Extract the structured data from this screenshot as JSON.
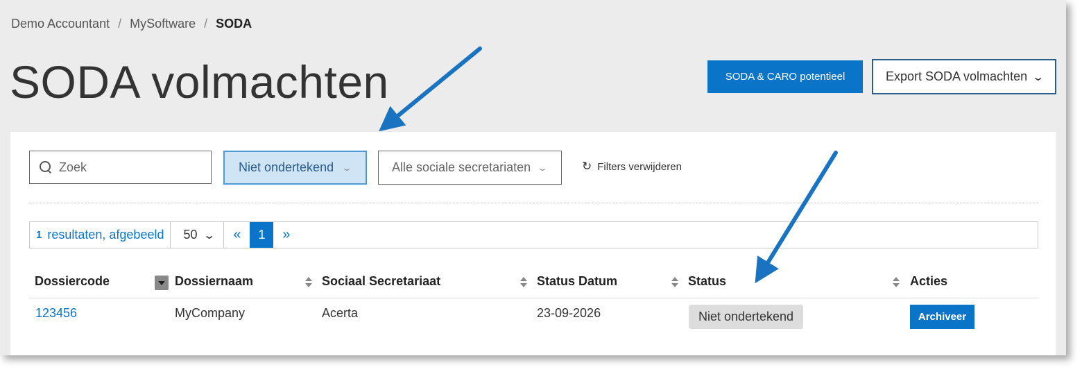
{
  "breadcrumb": {
    "items": [
      "Demo Accountant",
      "MySoftware",
      "SODA"
    ],
    "separator": "/"
  },
  "page_title": "SODA volmachten",
  "header_actions": {
    "potential_label": "SODA & CARO potentieel",
    "export_label": "Export SODA volmachten"
  },
  "filters": {
    "search_placeholder": "Zoek",
    "status_value": "Niet ondertekend",
    "secretariat_value": "Alle sociale secretariaten",
    "reset_label": "Filters verwijderen"
  },
  "pager": {
    "result_count": "1",
    "result_text": "resultaten, afgebeeld",
    "page_size": "50",
    "prev": "«",
    "current_page": "1",
    "next": "»"
  },
  "table": {
    "columns": [
      "Dossiercode",
      "Dossiernaam",
      "Sociaal Secretariaat",
      "Status Datum",
      "Status",
      "Acties"
    ],
    "rows": [
      {
        "code": "123456",
        "name": "MyCompany",
        "secretariat": "Acerta",
        "status_date": "23-09-2026",
        "status": "Niet ondertekend",
        "action": "Archiveer"
      }
    ]
  },
  "colors": {
    "primary": "#0a74c8",
    "annotation_arrow": "#1a73c0",
    "status_badge_bg": "#dddddd",
    "filter_active_bg": "#cfe4f5"
  },
  "icons": [
    "search-icon",
    "chevron-down-icon",
    "refresh-icon",
    "sort-icon"
  ]
}
